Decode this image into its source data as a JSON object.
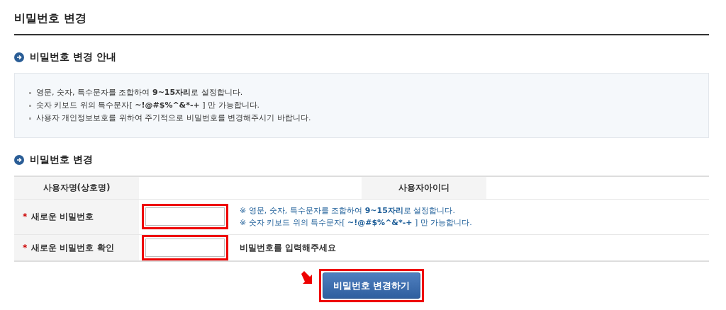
{
  "page_title": "비밀번호 변경",
  "guide": {
    "heading": "비밀번호 변경 안내",
    "items": [
      "영문, 숫자, 특수문자를 조합하여 **9~15자리**로 설정합니다.",
      "숫자 키보드 위의 특수문자[ **~!@#$%^&*-+** ] 만 가능합니다.",
      "사용자 개인정보보호를 위하여 주기적으로 비밀번호를 변경해주시기 바랍니다."
    ]
  },
  "form": {
    "heading": "비밀번호 변경",
    "info_row": [
      {
        "label": "사용자명(상호명)"
      },
      {
        "label": "사용자아이디"
      }
    ],
    "fields": [
      {
        "marker": "*",
        "label": "새로운 비밀번호",
        "highlighted": true,
        "hints": [
          "※ 영문, 숫자, 특수문자를 조합하여 **9~15자리**로 설정합니다.",
          "※ 숫자 키보드 위의 특수문자[ **~!@#$%^&*-+** ] 만 가능합니다."
        ]
      },
      {
        "marker": "*",
        "label": "새로운 비밀번호 확인",
        "highlighted": true,
        "message": "비밀번호를 입력해주세요"
      }
    ]
  },
  "submit": {
    "label": "비밀번호 변경하기",
    "highlighted": true,
    "pointer_arrow": true
  }
}
